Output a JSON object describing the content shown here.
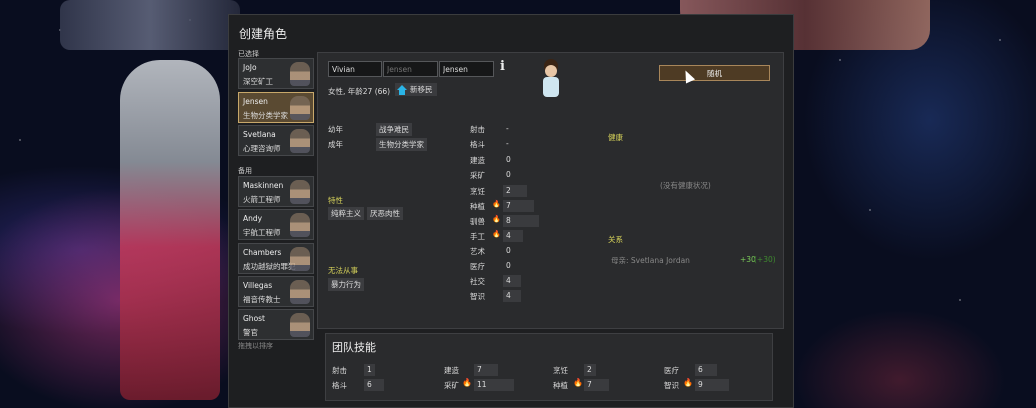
{
  "window": {
    "title": "创建角色"
  },
  "sections": {
    "selected": "已选择",
    "reserve": "备用"
  },
  "pawns_selected": [
    {
      "name": "JoJo",
      "job": "深空矿工"
    },
    {
      "name": "Jensen",
      "job": "生物分类学家"
    },
    {
      "name": "Svetlana",
      "job": "心理咨询师"
    }
  ],
  "pawns_reserve": [
    {
      "name": "Maskinnen",
      "job": "火箭工程师"
    },
    {
      "name": "Andy",
      "job": "宇航工程师"
    },
    {
      "name": "Chambers",
      "job": "成功越狱的罪犯"
    },
    {
      "name": "Villegas",
      "job": "福音传教士"
    },
    {
      "name": "Ghost",
      "job": "警官"
    }
  ],
  "drag_hint": "拖拽以排序",
  "pawn": {
    "first_name": "Vivian",
    "nick_name_placeholder": "Jensen",
    "last_name": "Jensen",
    "gender_age": "女性, 年龄27 (66)",
    "faction": "新移民",
    "random_label": "随机",
    "backstory": [
      {
        "label": "幼年",
        "value": "战争难民"
      },
      {
        "label": "成年",
        "value": "生物分类学家"
      }
    ],
    "traits_title": "特性",
    "traits": [
      "纯粹主义",
      "厌恶肉性"
    ],
    "incapable_title": "无法从事",
    "incapable": [
      "暴力行为"
    ],
    "skills": [
      {
        "name": "射击",
        "value": "-",
        "flame": 0
      },
      {
        "name": "格斗",
        "value": "-",
        "flame": 0
      },
      {
        "name": "建造",
        "value": "0",
        "flame": 0
      },
      {
        "name": "采矿",
        "value": "0",
        "flame": 0
      },
      {
        "name": "烹饪",
        "value": "2",
        "flame": 0
      },
      {
        "name": "种植",
        "value": "7",
        "flame": 1
      },
      {
        "name": "驯兽",
        "value": "8",
        "flame": 1
      },
      {
        "name": "手工",
        "value": "4",
        "flame": 1
      },
      {
        "name": "艺术",
        "value": "0",
        "flame": 0
      },
      {
        "name": "医疗",
        "value": "0",
        "flame": 0
      },
      {
        "name": "社交",
        "value": "4",
        "flame": 0
      },
      {
        "name": "智识",
        "value": "4",
        "flame": 0
      }
    ],
    "health_title": "健康",
    "health_empty": "(没有健康状况)",
    "relations_title": "关系",
    "relation": {
      "who": "母亲: Svetlana Jordan",
      "value": "+30",
      "paren": "(+30)"
    }
  },
  "team": {
    "title": "团队技能",
    "skills": [
      {
        "name": "射击",
        "value": "1",
        "flame": 0
      },
      {
        "name": "建造",
        "value": "7",
        "flame": 0
      },
      {
        "name": "烹饪",
        "value": "2",
        "flame": 0
      },
      {
        "name": "医疗",
        "value": "6",
        "flame": 0
      },
      {
        "name": "格斗",
        "value": "6",
        "flame": 0
      },
      {
        "name": "采矿",
        "value": "11",
        "flame": 2
      },
      {
        "name": "种植",
        "value": "7",
        "flame": 1
      },
      {
        "name": "智识",
        "value": "9",
        "flame": 2
      }
    ]
  }
}
